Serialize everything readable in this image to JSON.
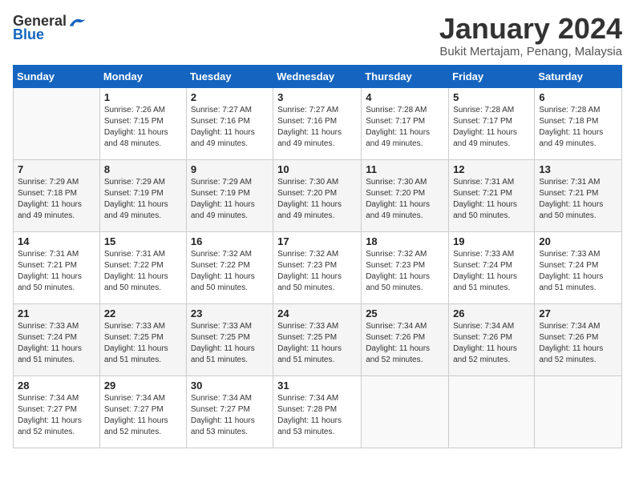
{
  "header": {
    "logo_general": "General",
    "logo_blue": "Blue",
    "title": "January 2024",
    "subtitle": "Bukit Mertajam, Penang, Malaysia"
  },
  "days_of_week": [
    "Sunday",
    "Monday",
    "Tuesday",
    "Wednesday",
    "Thursday",
    "Friday",
    "Saturday"
  ],
  "weeks": [
    [
      {
        "day": "",
        "info": ""
      },
      {
        "day": "1",
        "info": "Sunrise: 7:26 AM\nSunset: 7:15 PM\nDaylight: 11 hours\nand 48 minutes."
      },
      {
        "day": "2",
        "info": "Sunrise: 7:27 AM\nSunset: 7:16 PM\nDaylight: 11 hours\nand 49 minutes."
      },
      {
        "day": "3",
        "info": "Sunrise: 7:27 AM\nSunset: 7:16 PM\nDaylight: 11 hours\nand 49 minutes."
      },
      {
        "day": "4",
        "info": "Sunrise: 7:28 AM\nSunset: 7:17 PM\nDaylight: 11 hours\nand 49 minutes."
      },
      {
        "day": "5",
        "info": "Sunrise: 7:28 AM\nSunset: 7:17 PM\nDaylight: 11 hours\nand 49 minutes."
      },
      {
        "day": "6",
        "info": "Sunrise: 7:28 AM\nSunset: 7:18 PM\nDaylight: 11 hours\nand 49 minutes."
      }
    ],
    [
      {
        "day": "7",
        "info": "Sunrise: 7:29 AM\nSunset: 7:18 PM\nDaylight: 11 hours\nand 49 minutes."
      },
      {
        "day": "8",
        "info": "Sunrise: 7:29 AM\nSunset: 7:19 PM\nDaylight: 11 hours\nand 49 minutes."
      },
      {
        "day": "9",
        "info": "Sunrise: 7:29 AM\nSunset: 7:19 PM\nDaylight: 11 hours\nand 49 minutes."
      },
      {
        "day": "10",
        "info": "Sunrise: 7:30 AM\nSunset: 7:20 PM\nDaylight: 11 hours\nand 49 minutes."
      },
      {
        "day": "11",
        "info": "Sunrise: 7:30 AM\nSunset: 7:20 PM\nDaylight: 11 hours\nand 49 minutes."
      },
      {
        "day": "12",
        "info": "Sunrise: 7:31 AM\nSunset: 7:21 PM\nDaylight: 11 hours\nand 50 minutes."
      },
      {
        "day": "13",
        "info": "Sunrise: 7:31 AM\nSunset: 7:21 PM\nDaylight: 11 hours\nand 50 minutes."
      }
    ],
    [
      {
        "day": "14",
        "info": "Sunrise: 7:31 AM\nSunset: 7:21 PM\nDaylight: 11 hours\nand 50 minutes."
      },
      {
        "day": "15",
        "info": "Sunrise: 7:31 AM\nSunset: 7:22 PM\nDaylight: 11 hours\nand 50 minutes."
      },
      {
        "day": "16",
        "info": "Sunrise: 7:32 AM\nSunset: 7:22 PM\nDaylight: 11 hours\nand 50 minutes."
      },
      {
        "day": "17",
        "info": "Sunrise: 7:32 AM\nSunset: 7:23 PM\nDaylight: 11 hours\nand 50 minutes."
      },
      {
        "day": "18",
        "info": "Sunrise: 7:32 AM\nSunset: 7:23 PM\nDaylight: 11 hours\nand 50 minutes."
      },
      {
        "day": "19",
        "info": "Sunrise: 7:33 AM\nSunset: 7:24 PM\nDaylight: 11 hours\nand 51 minutes."
      },
      {
        "day": "20",
        "info": "Sunrise: 7:33 AM\nSunset: 7:24 PM\nDaylight: 11 hours\nand 51 minutes."
      }
    ],
    [
      {
        "day": "21",
        "info": "Sunrise: 7:33 AM\nSunset: 7:24 PM\nDaylight: 11 hours\nand 51 minutes."
      },
      {
        "day": "22",
        "info": "Sunrise: 7:33 AM\nSunset: 7:25 PM\nDaylight: 11 hours\nand 51 minutes."
      },
      {
        "day": "23",
        "info": "Sunrise: 7:33 AM\nSunset: 7:25 PM\nDaylight: 11 hours\nand 51 minutes."
      },
      {
        "day": "24",
        "info": "Sunrise: 7:33 AM\nSunset: 7:25 PM\nDaylight: 11 hours\nand 51 minutes."
      },
      {
        "day": "25",
        "info": "Sunrise: 7:34 AM\nSunset: 7:26 PM\nDaylight: 11 hours\nand 52 minutes."
      },
      {
        "day": "26",
        "info": "Sunrise: 7:34 AM\nSunset: 7:26 PM\nDaylight: 11 hours\nand 52 minutes."
      },
      {
        "day": "27",
        "info": "Sunrise: 7:34 AM\nSunset: 7:26 PM\nDaylight: 11 hours\nand 52 minutes."
      }
    ],
    [
      {
        "day": "28",
        "info": "Sunrise: 7:34 AM\nSunset: 7:27 PM\nDaylight: 11 hours\nand 52 minutes."
      },
      {
        "day": "29",
        "info": "Sunrise: 7:34 AM\nSunset: 7:27 PM\nDaylight: 11 hours\nand 52 minutes."
      },
      {
        "day": "30",
        "info": "Sunrise: 7:34 AM\nSunset: 7:27 PM\nDaylight: 11 hours\nand 53 minutes."
      },
      {
        "day": "31",
        "info": "Sunrise: 7:34 AM\nSunset: 7:28 PM\nDaylight: 11 hours\nand 53 minutes."
      },
      {
        "day": "",
        "info": ""
      },
      {
        "day": "",
        "info": ""
      },
      {
        "day": "",
        "info": ""
      }
    ]
  ]
}
